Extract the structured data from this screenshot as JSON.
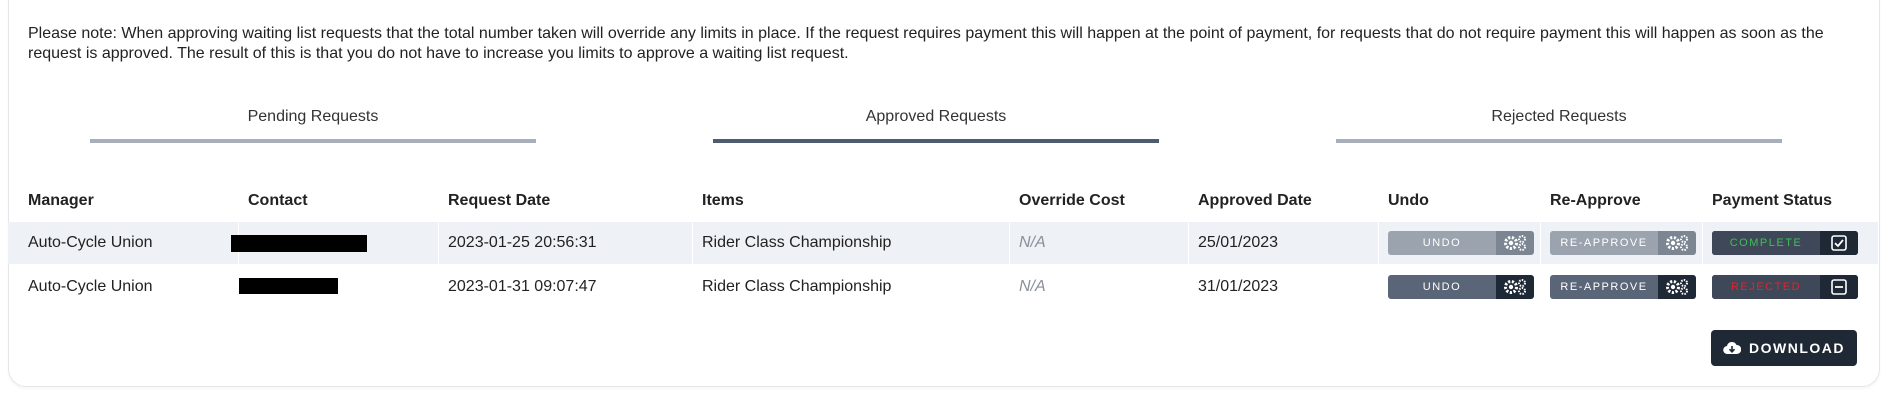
{
  "notice": "Please note: When approving waiting list requests that the total number taken will override any limits in place. If the request requires payment this will happen at the point of payment, for requests that do not require payment this will happen as soon as the request is approved. The result of this is that you do not have to increase you limits to approve a waiting list request.",
  "tabs": [
    {
      "label": "Pending Requests",
      "active": false
    },
    {
      "label": "Approved Requests",
      "active": true
    },
    {
      "label": "Rejected Requests",
      "active": false
    }
  ],
  "table": {
    "headers": {
      "manager": "Manager",
      "contact": "Contact",
      "request_date": "Request Date",
      "items": "Items",
      "override_cost": "Override Cost",
      "approved_date": "Approved Date",
      "undo": "Undo",
      "reapprove": "Re-Approve",
      "payment_status": "Payment Status"
    },
    "rows": [
      {
        "manager": "Auto-Cycle Union",
        "contact": "",
        "request_date": "2023-01-25 20:56:31",
        "items": "Rider Class Championship",
        "override_cost": "N/A",
        "approved_date": "25/01/2023",
        "undo_label": "UNDO",
        "reapprove_label": "RE-APPROVE",
        "payment_status": "COMPLETE",
        "status_color": "#3fbf5a"
      },
      {
        "manager": "Auto-Cycle Union",
        "contact": "",
        "request_date": "2023-01-31 09:07:47",
        "items": "Rider Class Championship",
        "override_cost": "N/A",
        "approved_date": "31/01/2023",
        "undo_label": "UNDO",
        "reapprove_label": "RE-APPROVE",
        "payment_status": "REJECTED",
        "status_color": "#e0242c"
      }
    ]
  },
  "download_label": "DOWNLOAD",
  "icons": {
    "gear": "gears-icon",
    "checkbox": "checkbox-checked-icon",
    "minus": "minus-square-icon",
    "cloud": "cloud-download-icon"
  }
}
